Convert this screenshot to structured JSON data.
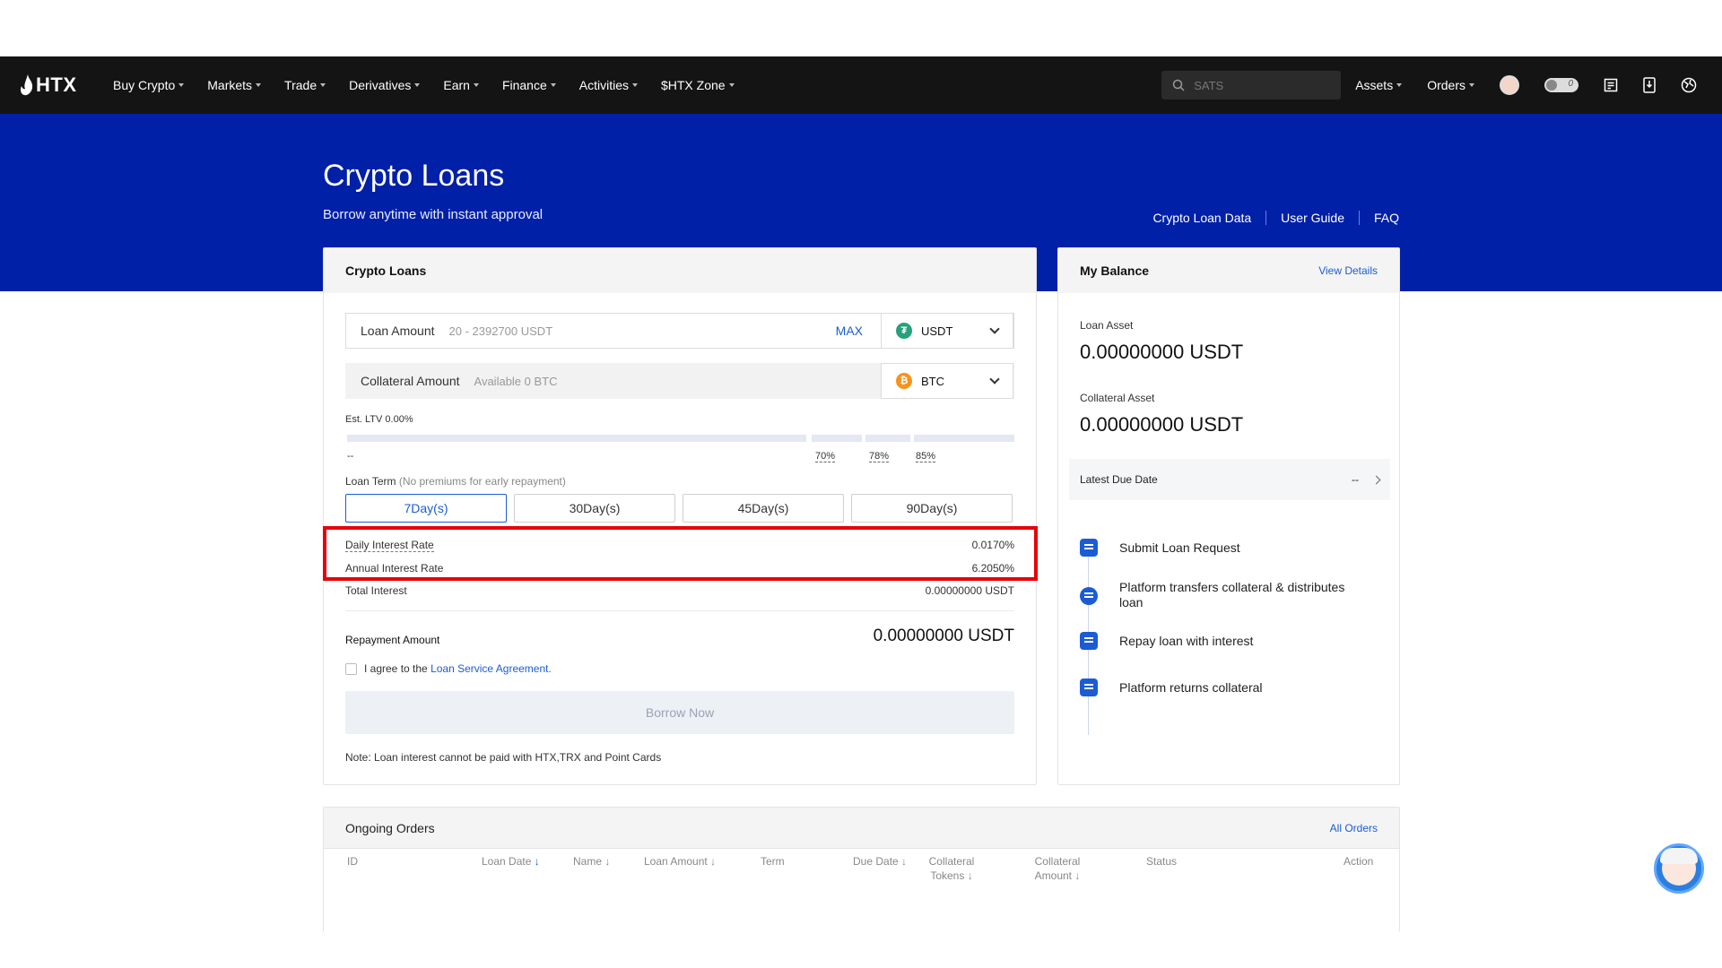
{
  "nav": {
    "logo": "HTX",
    "items": [
      "Buy Crypto",
      "Markets",
      "Trade",
      "Derivatives",
      "Earn",
      "Finance",
      "Activities",
      "$HTX Zone"
    ],
    "search_placeholder": "SATS",
    "assets": "Assets",
    "orders": "Orders",
    "toggle_count": "0"
  },
  "hero": {
    "title": "Crypto Loans",
    "subtitle": "Borrow anytime with instant approval",
    "links": [
      "Crypto Loan Data",
      "User Guide",
      "FAQ"
    ]
  },
  "loan": {
    "title": "Crypto Loans",
    "loan_amount_label": "Loan Amount",
    "loan_amount_placeholder": "20 - 2392700 USDT",
    "max": "MAX",
    "loan_coin": "USDT",
    "collateral_label": "Collateral Amount",
    "collateral_placeholder": "Available 0 BTC",
    "collateral_coin": "BTC",
    "ltv_label": "Est. LTV 0.00%",
    "ltv_current": "--",
    "ltv_ticks": [
      "70%",
      "78%",
      "85%"
    ],
    "term_label": "Loan Term",
    "term_note": "(No premiums for early repayment)",
    "terms": [
      "7Day(s)",
      "30Day(s)",
      "45Day(s)",
      "90Day(s)"
    ],
    "daily_rate_label": "Daily Interest Rate",
    "daily_rate": "0.0170%",
    "annual_rate_label": "Annual Interest Rate",
    "annual_rate": "6.2050%",
    "total_interest_label": "Total Interest",
    "total_interest": "0.00000000 USDT",
    "repay_label": "Repayment Amount",
    "repay_value": "0.00000000 USDT",
    "agree_prefix": "I agree to the ",
    "agree_link": "Loan Service Agreement.",
    "borrow_btn": "Borrow Now",
    "note": "Note: Loan interest cannot be paid with HTX,TRX and Point Cards"
  },
  "balance": {
    "title": "My Balance",
    "view_details": "View Details",
    "loan_asset_label": "Loan Asset",
    "loan_asset_value": "0.00000000 USDT",
    "collateral_asset_label": "Collateral Asset",
    "collateral_asset_value": "0.00000000 USDT",
    "due_label": "Latest Due Date",
    "due_value": "--",
    "steps": [
      "Submit Loan Request",
      "Platform transfers collateral & distributes loan",
      "Repay loan with interest",
      "Platform returns collateral"
    ]
  },
  "orders": {
    "title": "Ongoing Orders",
    "all_orders": "All Orders",
    "columns": [
      "ID",
      "Loan Date",
      "Name",
      "Loan Amount",
      "Term",
      "Due Date",
      "Collateral Tokens",
      "Collateral Amount",
      "Status",
      "Action"
    ]
  },
  "colors": {
    "brand_blue": "#0020a8",
    "link_blue": "#1b5cd6",
    "highlight_red": "#e8000b",
    "nav_bg": "#141414"
  }
}
